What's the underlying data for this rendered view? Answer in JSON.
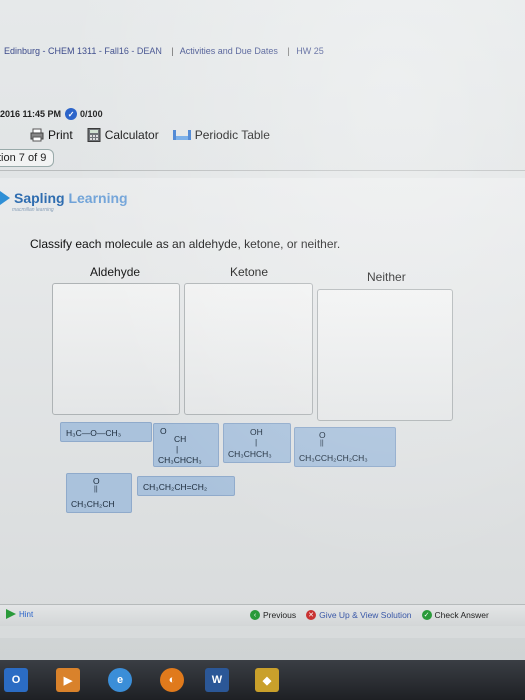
{
  "breadcrumb": {
    "items": [
      "Edinburg - CHEM 1311 - Fall16 - DEAN",
      "Activities and Due Dates",
      "HW 25"
    ]
  },
  "status": {
    "timestamp": "2016 11:45 PM",
    "score": "0/100"
  },
  "toolbar": {
    "print": "Print",
    "calculator": "Calculator",
    "periodic_table": "Periodic Table"
  },
  "question_tab": "tion 7 of 9",
  "brand": {
    "name_a": "Sapling",
    "name_b": " Learning",
    "sub": "macmillan learning"
  },
  "prompt": "Classify each molecule as an aldehyde, ketone, or neither.",
  "categories": [
    "Aldehyde",
    "Ketone",
    "Neither"
  ],
  "molecules": {
    "m1": "H₃C—O—CH₃",
    "m2_top": "O",
    "m2_mid": "CH",
    "m2_bot": "CH₃CHCH₃",
    "m3_top": "OH",
    "m3_bot": "CH₃CHCH₃",
    "m4_top": "O",
    "m4_bot": "CH₃CCH₂CH₂CH₃",
    "m5": "CH₃CH₂CH=CH₂",
    "m6_top": "O",
    "m6_bot": "CH₃CH₂CH"
  },
  "bottom": {
    "hint": "Hint",
    "previous": "Previous",
    "give_up": "Give Up & View Solution",
    "check": "Check Answer"
  },
  "taskbar": {
    "word_label": "W"
  },
  "colors": {
    "tile": "#aac2dc",
    "brand": "#2f6db0",
    "score_icon": "#2a63c9"
  }
}
